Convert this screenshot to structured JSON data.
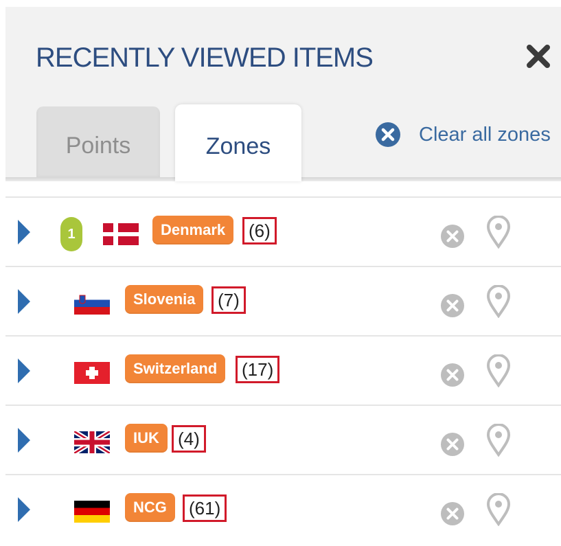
{
  "panel": {
    "title": "RECENTLY VIEWED ITEMS",
    "close_icon": "close-x-icon"
  },
  "tabs": [
    {
      "label": "Points",
      "active": false
    },
    {
      "label": "Zones",
      "active": true
    }
  ],
  "clear_all": {
    "label": "Clear all zones",
    "icon": "clear-circle-x-icon"
  },
  "zones": [
    {
      "badge": "1",
      "flag": "denmark",
      "name": "Denmark",
      "count": "(6)"
    },
    {
      "badge": "",
      "flag": "slovenia",
      "name": "Slovenia",
      "count": "(7)"
    },
    {
      "badge": "",
      "flag": "switzerland",
      "name": "Switzerland",
      "count": "(17)"
    },
    {
      "badge": "",
      "flag": "uk",
      "name": "IUK",
      "count": "(4)"
    },
    {
      "badge": "",
      "flag": "germany",
      "name": "NCG",
      "count": "(61)"
    }
  ],
  "colors": {
    "title": "#2d4d80",
    "zone_tag": "#f28537",
    "count_highlight": "#d11a2a",
    "badge": "#a9c63b",
    "expander": "#2f6db0",
    "muted_icon": "#bdbdbd"
  }
}
